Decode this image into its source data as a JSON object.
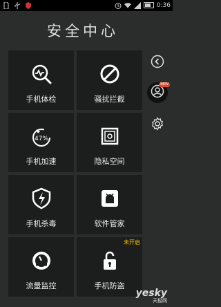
{
  "status_bar": {
    "time": "0:36",
    "left_icons": [
      "sim-icon",
      "usb-icon",
      "shield-icon"
    ],
    "right_icons": [
      "alarm-icon",
      "wifi-icon",
      "signal-icon",
      "battery-icon"
    ]
  },
  "header": {
    "title": "安全中心"
  },
  "tiles": [
    {
      "label": "手机体检",
      "icon": "checkup-icon"
    },
    {
      "label": "骚扰拦截",
      "icon": "block-icon"
    },
    {
      "label": "手机加速",
      "icon": "rocket-icon",
      "percent": "47%"
    },
    {
      "label": "隐私空间",
      "icon": "safe-icon"
    },
    {
      "label": "手机杀毒",
      "icon": "antivirus-icon"
    },
    {
      "label": "软件管家",
      "icon": "app-manager-icon"
    },
    {
      "label": "流量监控",
      "icon": "gauge-icon"
    },
    {
      "label": "手机防盗",
      "icon": "lock-icon",
      "badge": "未开启"
    }
  ],
  "sidebar": {
    "items": [
      "back-icon",
      "account-icon",
      "settings-icon"
    ],
    "account_badge": "NEW"
  },
  "watermark": {
    "main": "yesky",
    "sub": "天极网"
  },
  "colors": {
    "background": "#2b2d2c",
    "tile": "#1c1d1d",
    "badge": "#f2c200"
  }
}
